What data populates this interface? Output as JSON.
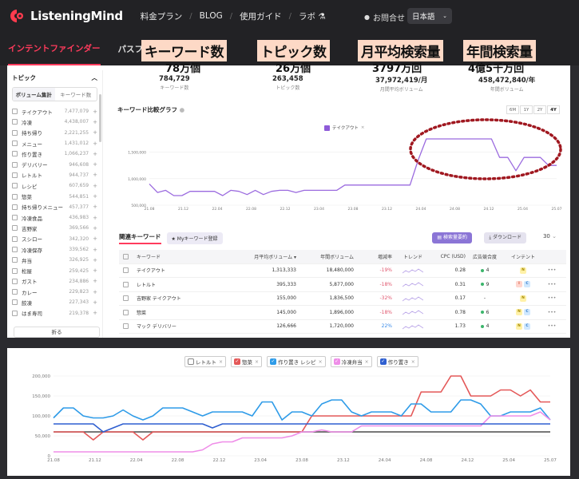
{
  "nav": {
    "logo": "ListeningMind",
    "items": [
      "料金プラン",
      "BLOG",
      "使用ガイド",
      "ラボ"
    ],
    "contact": "お問合せ",
    "language": "日本語"
  },
  "subnav": {
    "tabs": [
      "インテントファインダー",
      "パスファインダー"
    ]
  },
  "highlights": [
    {
      "label": "キーワード数",
      "value": "78万個"
    },
    {
      "label": "トピック数",
      "value": "26万個"
    },
    {
      "label": "月平均検索量",
      "value": "3797万回"
    },
    {
      "label": "年間検索量",
      "value": "4億5千万回"
    }
  ],
  "stats": [
    {
      "value": "784,729",
      "label": "キーワード数"
    },
    {
      "value": "263,458",
      "label": "トピック数"
    },
    {
      "value": "37,972,419/月",
      "label": "月間平均ボリューム"
    },
    {
      "value": "458,472,840/年",
      "label": "年間ボリューム"
    }
  ],
  "sidebar": {
    "title": "トピック",
    "tabs": [
      "ボリューム集計",
      "キーワード数"
    ],
    "items": [
      {
        "label": "テイクアウト",
        "count": "7,477,079"
      },
      {
        "label": "冷凍",
        "count": "4,438,007"
      },
      {
        "label": "持ち帰り",
        "count": "2,221,255"
      },
      {
        "label": "メニュー",
        "count": "1,431,012"
      },
      {
        "label": "作り置き",
        "count": "1,066,237"
      },
      {
        "label": "デリバリー",
        "count": "946,608"
      },
      {
        "label": "レトルト",
        "count": "944,737"
      },
      {
        "label": "レシピ",
        "count": "607,659"
      },
      {
        "label": "惣菜",
        "count": "544,851"
      },
      {
        "label": "持ち帰りメニュー",
        "count": "457,377"
      },
      {
        "label": "冷凍食品",
        "count": "436,983"
      },
      {
        "label": "吉野家",
        "count": "369,566"
      },
      {
        "label": "スシロー",
        "count": "342,320"
      },
      {
        "label": "冷凍保存",
        "count": "339,562"
      },
      {
        "label": "弁当",
        "count": "326,925"
      },
      {
        "label": "松屋",
        "count": "259,425"
      },
      {
        "label": "ガスト",
        "count": "234,886"
      },
      {
        "label": "カレー",
        "count": "229,823"
      },
      {
        "label": "餃凍",
        "count": "227,343"
      },
      {
        "label": "はま寿司",
        "count": "219,378"
      }
    ],
    "fold": "折る"
  },
  "graph": {
    "title": "キーワード比較グラフ",
    "periods": [
      "6M",
      "1Y",
      "2Y",
      "4Y"
    ],
    "active_period": "4Y",
    "legend": "テイクアウト",
    "color": "#9b6bdf"
  },
  "chart_data": [
    {
      "type": "line",
      "title": "キーワード比較グラフ",
      "x": [
        "21.08",
        "21.12",
        "22.04",
        "22.08",
        "22.12",
        "23.04",
        "23.08",
        "23.12",
        "24.04",
        "24.08",
        "24.12",
        "25.04",
        "25.07"
      ],
      "yticks": [
        "500,000",
        "1,000,000",
        "1,500,000"
      ],
      "ylim": [
        500000,
        1900000
      ],
      "series": [
        {
          "name": "テイクアウト",
          "values": [
            900000,
            740000,
            780000,
            680000,
            680000,
            760000,
            760000,
            760000,
            760000,
            680000,
            780000,
            760000,
            700000,
            780000,
            700000,
            760000,
            780000,
            780000,
            740000,
            780000,
            780000,
            780000,
            780000,
            780000,
            880000,
            880000,
            880000,
            880000,
            880000,
            880000,
            880000,
            880000,
            880000,
            1350000,
            1750000,
            1750000,
            1750000,
            1750000,
            1750000,
            1750000,
            1750000,
            1750000,
            1750000,
            1400000,
            1400000,
            1150000,
            1400000,
            1400000,
            1400000,
            1250000,
            1250000
          ]
        }
      ]
    },
    {
      "type": "line",
      "x": [
        "21.08",
        "21.12",
        "22.04",
        "22.08",
        "22.12",
        "23.04",
        "23.08",
        "23.12",
        "24.04",
        "24.08",
        "24.12",
        "25.04",
        "25.07"
      ],
      "yticks": [
        "0",
        "50,000",
        "100,000",
        "150,000",
        "200,000"
      ],
      "ylim": [
        0,
        210000
      ],
      "series": [
        {
          "name": "レトルト",
          "values": [
            60000,
            60000,
            60000,
            60000,
            60000,
            60000,
            60000,
            60000,
            60000,
            60000,
            60000,
            60000,
            60000,
            60000,
            60000,
            60000,
            60000,
            60000,
            60000,
            60000,
            60000,
            60000,
            60000,
            60000,
            60000,
            60000,
            60000,
            60000,
            60000,
            60000,
            60000,
            60000,
            60000,
            60000,
            60000,
            60000,
            60000,
            60000,
            60000,
            60000,
            60000,
            60000,
            60000,
            60000,
            60000,
            60000,
            60000,
            60000,
            60000,
            60000,
            60000
          ]
        },
        {
          "name": "惣菜",
          "values": [
            60000,
            60000,
            60000,
            60000,
            40000,
            60000,
            60000,
            60000,
            60000,
            40000,
            60000,
            60000,
            60000,
            60000,
            60000,
            60000,
            60000,
            60000,
            60000,
            60000,
            60000,
            60000,
            60000,
            60000,
            60000,
            60000,
            100000,
            100000,
            100000,
            100000,
            100000,
            100000,
            100000,
            100000,
            100000,
            100000,
            100000,
            160000,
            160000,
            160000,
            200000,
            200000,
            150000,
            150000,
            150000,
            165000,
            165000,
            150000,
            165000,
            135000,
            135000
          ]
        },
        {
          "name": "作り置き レシピ",
          "values": [
            95000,
            120000,
            120000,
            100000,
            95000,
            95000,
            100000,
            115000,
            100000,
            90000,
            100000,
            120000,
            120000,
            120000,
            110000,
            100000,
            110000,
            110000,
            110000,
            110000,
            100000,
            135000,
            135000,
            90000,
            110000,
            110000,
            100000,
            130000,
            140000,
            140000,
            110000,
            100000,
            110000,
            110000,
            110000,
            100000,
            130000,
            130000,
            110000,
            110000,
            110000,
            140000,
            140000,
            130000,
            100000,
            100000,
            110000,
            110000,
            110000,
            120000,
            90000
          ]
        },
        {
          "name": "冷凍弁当",
          "values": [
            10000,
            10000,
            10000,
            10000,
            10000,
            10000,
            10000,
            10000,
            10000,
            10000,
            10000,
            10000,
            10000,
            10000,
            10000,
            15000,
            30000,
            35000,
            35000,
            45000,
            45000,
            45000,
            45000,
            45000,
            50000,
            60000,
            60000,
            65000,
            60000,
            60000,
            60000,
            75000,
            75000,
            75000,
            75000,
            75000,
            75000,
            75000,
            75000,
            75000,
            75000,
            75000,
            75000,
            75000,
            100000,
            100000,
            100000,
            100000,
            100000,
            110000,
            90000
          ]
        },
        {
          "name": "作り置き",
          "values": [
            80000,
            80000,
            80000,
            80000,
            80000,
            60000,
            70000,
            80000,
            80000,
            80000,
            80000,
            80000,
            80000,
            80000,
            80000,
            80000,
            70000,
            80000,
            80000,
            80000,
            80000,
            80000,
            80000,
            80000,
            80000,
            80000,
            80000,
            80000,
            80000,
            80000,
            80000,
            80000,
            80000,
            80000,
            80000,
            80000,
            80000,
            80000,
            80000,
            80000,
            80000,
            80000,
            80000,
            80000,
            80000,
            80000,
            80000,
            80000,
            80000,
            80000,
            80000
          ]
        }
      ]
    }
  ],
  "related": {
    "title": "関連キーワード",
    "my_kw": "Myキーワード登録",
    "summary_btn": "検索量要約",
    "download_btn": "ダウンロード",
    "count": "30",
    "headers": [
      "キーワード",
      "月平均ボリューム ▾",
      "年間ボリューム",
      "増減率",
      "トレンド",
      "CPC (USD)",
      "広告競合度",
      "インテント"
    ],
    "rows": [
      {
        "kw": "テイクアウト",
        "vol": "1,313,333",
        "yr": "18,480,000",
        "gr": "-19%",
        "cpc": "0.28",
        "comp": "4",
        "tags": [
          "N"
        ]
      },
      {
        "kw": "レトルト",
        "vol": "395,333",
        "yr": "5,877,000",
        "gr": "-18%",
        "cpc": "0.31",
        "comp": "9",
        "tags": [
          "I",
          "C"
        ]
      },
      {
        "kw": "吉野家 テイクアウト",
        "vol": "155,000",
        "yr": "1,836,500",
        "gr": "-32%",
        "cpc": "0.17",
        "comp": "-",
        "tags": [
          "N"
        ]
      },
      {
        "kw": "惣菜",
        "vol": "145,000",
        "yr": "1,896,000",
        "gr": "-18%",
        "cpc": "0.78",
        "comp": "6",
        "tags": [
          "N",
          "C"
        ]
      },
      {
        "kw": "マック デリバリー",
        "vol": "126,666",
        "yr": "1,720,000",
        "gr": "22%",
        "cpc": "1.73",
        "comp": "4",
        "tags": [
          "N",
          "C"
        ]
      }
    ]
  },
  "bottom_legend": [
    {
      "label": "レトルト",
      "color": "#ffffff"
    },
    {
      "label": "惣菜",
      "color": "#e45858"
    },
    {
      "label": "作り置き レシピ",
      "color": "#2e9be8"
    },
    {
      "label": "冷凍弁当",
      "color": "#ef8de8"
    },
    {
      "label": "作り置き",
      "color": "#2f5fd0"
    }
  ]
}
